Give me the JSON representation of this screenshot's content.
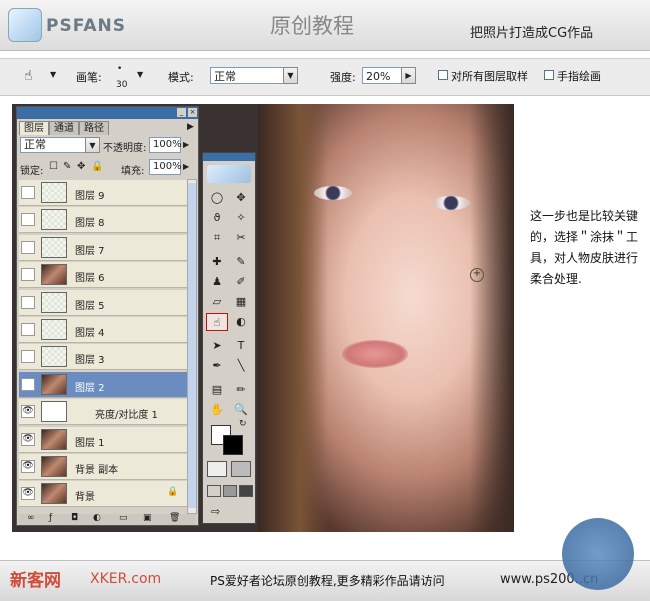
{
  "header": {
    "logo": "PSFANS",
    "title": "原创教程",
    "subtitle": "把照片打造成CG作品"
  },
  "options_bar": {
    "brush_label": "画笔:",
    "brush_size": "30",
    "mode_label": "模式:",
    "mode_value": "正常",
    "strength_label": "强度:",
    "strength_value": "20%",
    "sample_all_label": "对所有图层取样",
    "finger_paint_label": "手指绘画"
  },
  "layers_panel": {
    "tabs": [
      "图层",
      "通道",
      "路径"
    ],
    "blend_mode": "正常",
    "opacity_label": "不透明度:",
    "opacity_value": "100%",
    "lock_label": "锁定:",
    "fill_label": "填充:",
    "fill_value": "100%",
    "layers": [
      {
        "name": "图层 9",
        "visible": false,
        "thumb": "checker"
      },
      {
        "name": "图层 8",
        "visible": false,
        "thumb": "checker"
      },
      {
        "name": "图层 7",
        "visible": false,
        "thumb": "checker"
      },
      {
        "name": "图层 6",
        "visible": false,
        "thumb": "face"
      },
      {
        "name": "图层 5",
        "visible": false,
        "thumb": "checker"
      },
      {
        "name": "图层 4",
        "visible": false,
        "thumb": "checker"
      },
      {
        "name": "图层 3",
        "visible": false,
        "thumb": "checker"
      },
      {
        "name": "图层 2",
        "visible": true,
        "thumb": "face",
        "selected": true
      },
      {
        "name": "亮度/对比度 1",
        "visible": true,
        "thumb": "bw"
      },
      {
        "name": "图层 1",
        "visible": true,
        "thumb": "face"
      },
      {
        "name": "背景 副本",
        "visible": true,
        "thumb": "face"
      },
      {
        "name": "背景",
        "visible": true,
        "thumb": "face",
        "locked": true
      }
    ]
  },
  "toolbox": {
    "active_tool": "smudge-tool"
  },
  "description": "这一步也是比较关键的，选择＂涂抹＂工具，对人物皮肤进行柔合处理.",
  "footer": {
    "site": "新客网",
    "watermark": "XKER.com",
    "text": "PS爱好者论坛原创教程,更多精彩作品请访问",
    "url": "www.ps200..cn"
  }
}
